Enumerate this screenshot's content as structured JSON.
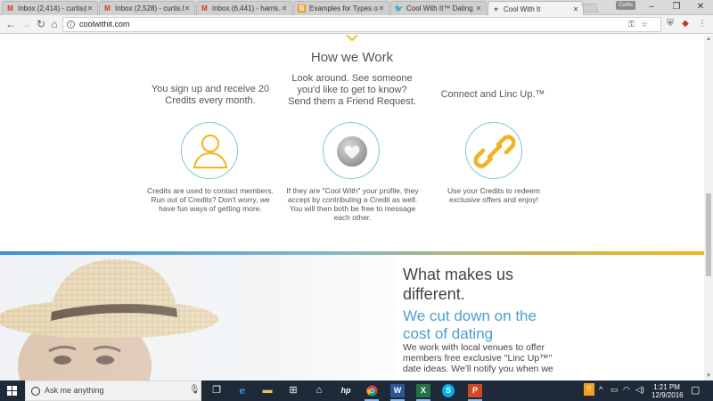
{
  "browser": {
    "tabs": [
      {
        "title": "Inbox (2,414) - curtis@",
        "icon": "gmail-icon"
      },
      {
        "title": "Inbox (2,528) - curtis.h",
        "icon": "gmail-icon"
      },
      {
        "title": "Inbox (6,441) - harris.c",
        "icon": "gmail-icon"
      },
      {
        "title": "Examples for Types of",
        "icon": "blogger-icon"
      },
      {
        "title": "Cool With It™ Dating",
        "icon": "twitter-icon"
      },
      {
        "title": "Cool With It",
        "icon": "heart-icon",
        "active": true
      }
    ],
    "profile_name": "Curtis",
    "url": "coolwithit.com"
  },
  "page": {
    "section_title": "How we Work",
    "steps": [
      {
        "heading": "You sign up and receive 20 Credits every month.",
        "description": "Credits are used to contact members. Run out of Credits? Don't worry, we have fun ways of getting more.",
        "icon": "user-icon"
      },
      {
        "heading": "Look around. See someone you'd like to get to know? Send them a Friend Request.",
        "description": "If they are \"Cool With\" your profile, they accept by contributing a Credit as well. You will then both be free to message each other.",
        "icon": "heart-icon"
      },
      {
        "heading": "Connect and Linc Up.™",
        "description": "Use your Credits to redeem exclusive offers and enjoy!",
        "icon": "link-icon"
      }
    ],
    "different": {
      "title": "What makes us different.",
      "subtitle": "We cut down on the cost of dating",
      "body": "We work with local venues to offer members free exclusive \"Linc Up™\" date ideas. We'll notify you when we"
    }
  },
  "taskbar": {
    "search_placeholder": "Ask me anything",
    "time": "1:21 PM",
    "date": "12/9/2016"
  },
  "colors": {
    "accent_blue": "#4a9fcf",
    "accent_gold": "#f2b31e",
    "circle_border": "#7fc6d8"
  }
}
